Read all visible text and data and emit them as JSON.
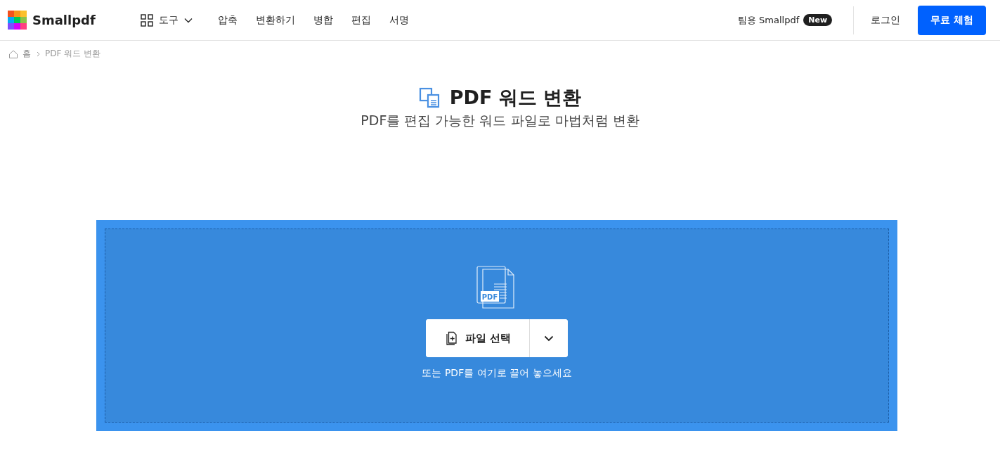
{
  "header": {
    "logo": "Smallpdf",
    "tools_menu": "도구",
    "nav": [
      "압축",
      "변환하기",
      "병합",
      "편집",
      "서명"
    ],
    "team": "팀용 Smallpdf",
    "team_badge": "New",
    "login": "로그인",
    "cta": "무료 체험"
  },
  "breadcrumb": [
    {
      "label": "홈",
      "current": false
    },
    {
      "label": "PDF 워드 변환",
      "current": true
    }
  ],
  "title": "PDF 워드 변환",
  "subtitle": "PDF를 편집 가능한 워드 파일로 마법처럼 변환",
  "dropzone": {
    "icon_label": "PDF",
    "choose_button": "파일 선택",
    "hint": "또는 PDF를 여기로 끌어 놓으세요"
  }
}
